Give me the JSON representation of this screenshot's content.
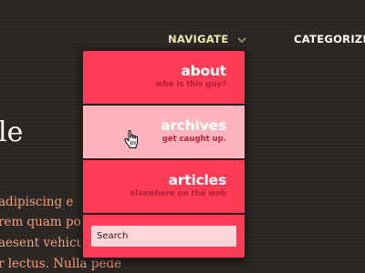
{
  "nav": {
    "navigate_label": "NAVIGATE",
    "categorize_label": "CATEGORIZE"
  },
  "hero": {
    "title_fragment": "le"
  },
  "body_text": [
    "adipiscing e",
    "rem quam po",
    "aesent vehicu",
    "r lectus. Nulla pede"
  ],
  "menu": {
    "items": [
      {
        "title": "about",
        "subtitle": "who is this guy?"
      },
      {
        "title": "archives",
        "subtitle": "get caught up."
      },
      {
        "title": "articles",
        "subtitle": "elsewhere on the web"
      }
    ],
    "search_placeholder": "Search"
  },
  "colors": {
    "background": "#2b2622",
    "menu_item": "#ff3c56",
    "menu_item_hover": "#ffb3bd",
    "subtitle": "#b0213a",
    "nav_text": "#f0e6b4",
    "body_text": "#f3a07e"
  },
  "icons": {
    "nav_chevron": "chevron-down-icon",
    "cursor": "hand-pointer-icon"
  }
}
